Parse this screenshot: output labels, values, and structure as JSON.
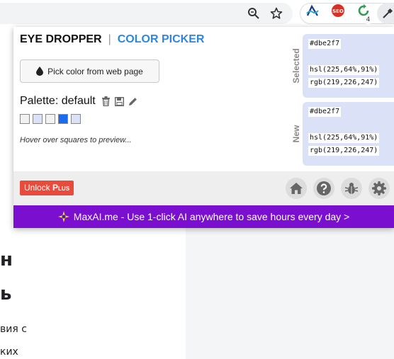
{
  "browser": {
    "icons": [
      "zoom-icon",
      "star-icon"
    ],
    "extensions": [
      "wavelength-icon",
      "seo-icon",
      "refresh-extension-icon",
      "eyedropper-extension-icon"
    ],
    "badge_count": "4"
  },
  "popup": {
    "tabs": {
      "eye_dropper": "EYE DROPPER",
      "separator": "|",
      "color_picker": "COLOR PICKER"
    },
    "pick_button_label": "Pick color from web page",
    "palette": {
      "label": "Palette: default",
      "swatches": [
        "#f2f2f2",
        "#dbe2f7",
        "#f2f2f2",
        "#1a6cf0",
        "#dbe2f7"
      ]
    },
    "hover_hint": "Hover over squares to preview...",
    "selected": {
      "label": "Selected",
      "hex": "#dbe2f7",
      "hsl": "hsl(225,64%,91%)",
      "rgb": "rgb(219,226,247)"
    },
    "new": {
      "label": "New",
      "hex": "#dbe2f7",
      "hsl": "hsl(225,64%,91%)",
      "rgb": "rgb(219,226,247)"
    },
    "footer": {
      "unlock_prefix": "Unlock",
      "unlock_plus": "Plus",
      "buttons": [
        "home-icon",
        "help-icon",
        "bug-icon",
        "settings-icon"
      ]
    },
    "banner": {
      "text": "MaxAI.me - Use 1-click AI anywhere to save hours every day >"
    }
  },
  "background_page": {
    "heading_line1": "н",
    "heading_line2": "ь",
    "para_line1": "вия с",
    "para_line2": "ких"
  },
  "colors": {
    "accent_blue": "#2e86de",
    "unlock_red": "#e84b3c",
    "banner_purple": "#7b0fcf",
    "card_bg": "#dbe2f7"
  }
}
